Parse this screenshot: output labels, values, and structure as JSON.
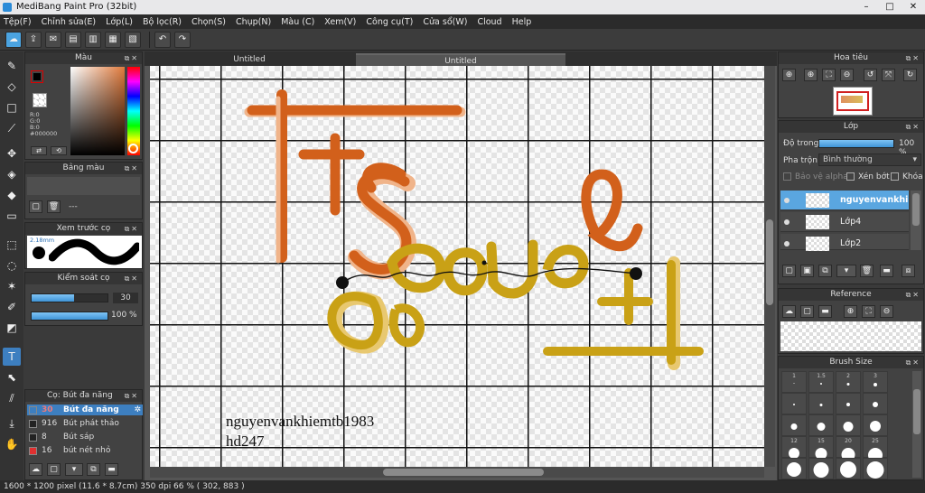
{
  "app": {
    "title": "MediBang Paint Pro (32bit)",
    "min": "–",
    "max": "□",
    "close": "✕"
  },
  "menu": [
    "Tệp(F)",
    "Chỉnh sửa(E)",
    "Lớp(L)",
    "Bộ lọc(R)",
    "Chọn(S)",
    "Chụp(N)",
    "Màu (C)",
    "Xem(V)",
    "Công cụ(T)",
    "Cửa sổ(W)",
    "Cloud",
    "Help"
  ],
  "tabs": [
    "Untitled",
    "Untitled"
  ],
  "color_panel": {
    "title": "Màu",
    "readout": [
      "R:0",
      "G:0",
      "B:0",
      "#000000"
    ],
    "fg_color": "#000000",
    "bg_color": "#ffffff"
  },
  "palette_panel": {
    "title": "Bảng màu",
    "placeholder": "---"
  },
  "preview_panel": {
    "title": "Xem trước cọ",
    "size": "2.18mm"
  },
  "brush_control": {
    "title": "Kiểm soát cọ",
    "size": 30,
    "opacity_label": "100 %",
    "opacity_fraction": 1.0
  },
  "brush_list": {
    "title": "Cọ: Bút đa năng",
    "items": [
      {
        "size": "30",
        "name": "Bút đa năng",
        "color": "#3d7fc0",
        "selected": true
      },
      {
        "size": "916",
        "name": "Bút phát thảo",
        "color": "#222222",
        "selected": false
      },
      {
        "size": "8",
        "name": "Bút sáp",
        "color": "#222222",
        "selected": false
      },
      {
        "size": "16",
        "name": "bút nét nhỏ",
        "color": "#e03030",
        "selected": false
      }
    ]
  },
  "navigator": {
    "title": "Hoa tiêu"
  },
  "layer_panel": {
    "title": "Lớp",
    "opacity_label": "Độ trong",
    "opacity_value": "100 %",
    "opacity_fraction": 1.0,
    "blend_label": "Pha trộn",
    "blend_value": "Bình thường",
    "protect_alpha": "Bảo vệ alpha",
    "clipping": "Xén bớt",
    "lock": "Khóa",
    "layers": [
      {
        "name": "nguyenvankhi",
        "selected": true
      },
      {
        "name": "Lớp4",
        "selected": false
      },
      {
        "name": "Lớp2",
        "selected": false
      }
    ]
  },
  "reference_panel": {
    "title": "Reference"
  },
  "brush_size_panel": {
    "title": "Brush Size",
    "sizes": [
      "1",
      "1.5",
      "2",
      "3",
      "",
      "",
      "",
      "",
      "",
      "",
      "",
      "",
      "12",
      "15",
      "20",
      "25",
      "",
      "",
      "",
      ""
    ]
  },
  "canvas": {
    "watermark_line1": "nguyenvankhiemtb1983",
    "watermark_line2": "hd247",
    "art_colors": {
      "orange": "#d2601b",
      "gold": "#c9a116",
      "peach": "#f0b48a"
    }
  },
  "status": "1600 * 1200 pixel   (11.6 * 8.7cm)   350 dpi   66 %   ( 302, 883 )"
}
